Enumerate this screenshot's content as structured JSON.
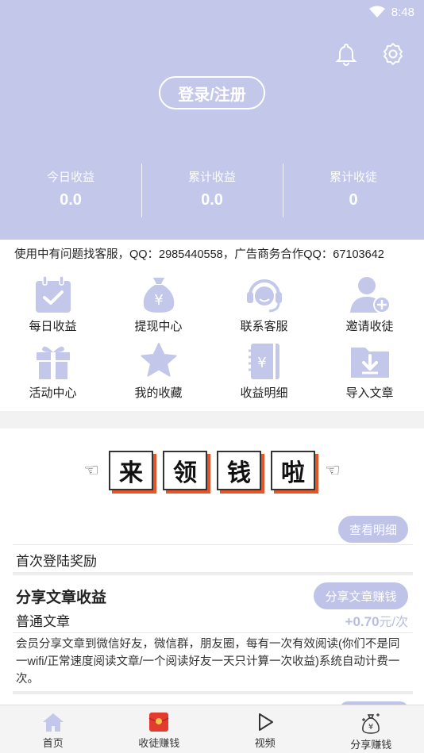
{
  "status_bar": {
    "time": "8:48"
  },
  "header": {
    "login_label": "登录/注册",
    "stats": [
      {
        "label": "今日收益",
        "value": "0.0"
      },
      {
        "label": "累计收益",
        "value": "0.0"
      },
      {
        "label": "累计收徒",
        "value": "0"
      }
    ]
  },
  "notice": "使用中有问题找客服，QQ：2985440558，广告商务合作QQ：67103642",
  "grid": [
    {
      "label": "每日收益",
      "icon": "calendar-check-icon"
    },
    {
      "label": "提现中心",
      "icon": "money-bag-icon"
    },
    {
      "label": "联系客服",
      "icon": "headset-icon"
    },
    {
      "label": "邀请收徒",
      "icon": "add-user-icon"
    },
    {
      "label": "活动中心",
      "icon": "gift-icon"
    },
    {
      "label": "我的收藏",
      "icon": "star-icon"
    },
    {
      "label": "收益明细",
      "icon": "ledger-icon"
    },
    {
      "label": "导入文章",
      "icon": "folder-import-icon"
    }
  ],
  "banner": {
    "tiles": [
      "来",
      "领",
      "钱",
      "啦"
    ]
  },
  "view_details_label": "查看明细",
  "first_login": {
    "title": "首次登陆奖励"
  },
  "share_article": {
    "title": "分享文章收益",
    "button": "分享文章赚钱",
    "type": "普通文章",
    "price_amount": "+0.70",
    "price_unit": "元/次",
    "description": "会员分享文章到微信好友，微信群，朋友圈，每有一次有效阅读(你们不是同一wifi/正常速度阅读文章/一个阅读好友一天只计算一次收益)系统自动计费一次。"
  },
  "tabs": [
    {
      "label": "首页",
      "icon": "home-icon"
    },
    {
      "label": "收徒赚钱",
      "icon": "red-envelope-icon"
    },
    {
      "label": "视频",
      "icon": "play-icon"
    },
    {
      "label": "分享赚钱",
      "icon": "money-share-icon"
    }
  ],
  "colors": {
    "header_bg": "#c3c7ea",
    "accent": "#bfc3e8",
    "banner_shadow": "#e5552a"
  }
}
